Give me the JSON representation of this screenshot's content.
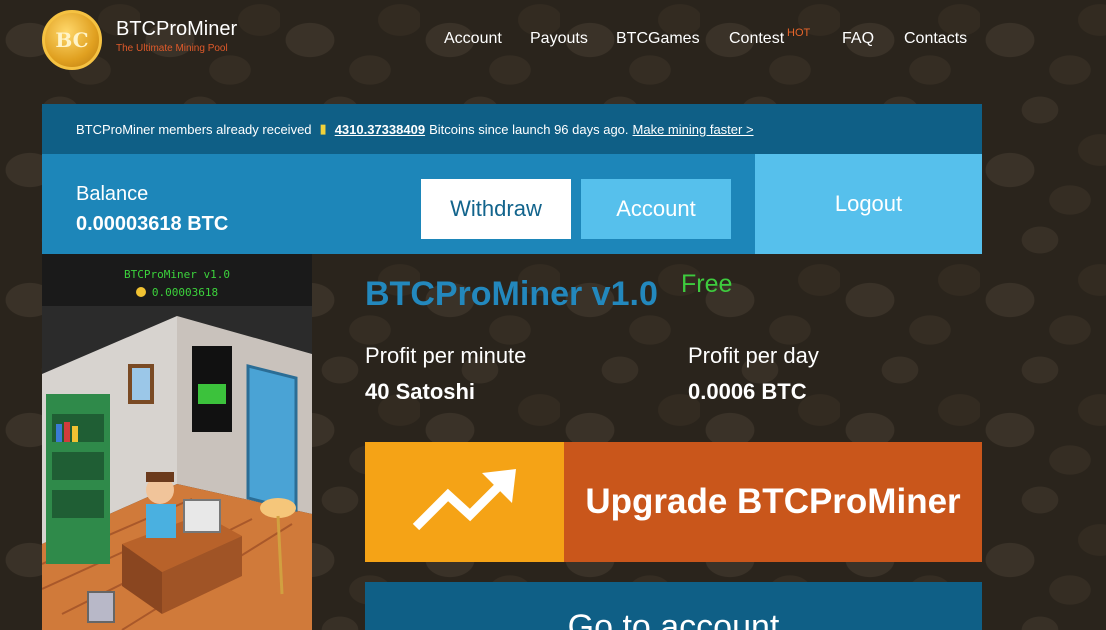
{
  "header": {
    "logo_text": "BC",
    "brand_name": "BTCProMiner",
    "tagline": "The Ultimate Mining Pool",
    "nav": [
      "Account",
      "Payouts",
      "BTCGames",
      "Contest",
      "FAQ",
      "Contacts"
    ],
    "hot_badge": "HOT"
  },
  "infobar": {
    "prefix": "BTCProMiner members already received",
    "amount": "4310.37338409",
    "suffix": "Bitcoins since launch 96 days ago.",
    "link": "Make mining faster >"
  },
  "balance": {
    "label": "Balance",
    "value": "0.00003618 BTC",
    "withdraw": "Withdraw",
    "account": "Account",
    "logout": "Logout"
  },
  "game": {
    "title": "BTCProMiner v1.0",
    "balance": "0.00003618"
  },
  "miner": {
    "title": "BTCProMiner v1.0",
    "badge": "Free",
    "profit_minute_label": "Profit per minute",
    "profit_minute_value": "40 Satoshi",
    "profit_day_label": "Profit per day",
    "profit_day_value": "0.0006 BTC",
    "upgrade_label": "Upgrade BTCProMiner",
    "go_account_label": "Go to account"
  },
  "colors": {
    "accent_blue": "#1d86b9",
    "light_blue": "#56c0ec",
    "dark_blue": "#0f5f86",
    "upgrade_orange": "#c9561b",
    "upgrade_yellow": "#f5a316",
    "free_green": "#3ecb3e"
  }
}
